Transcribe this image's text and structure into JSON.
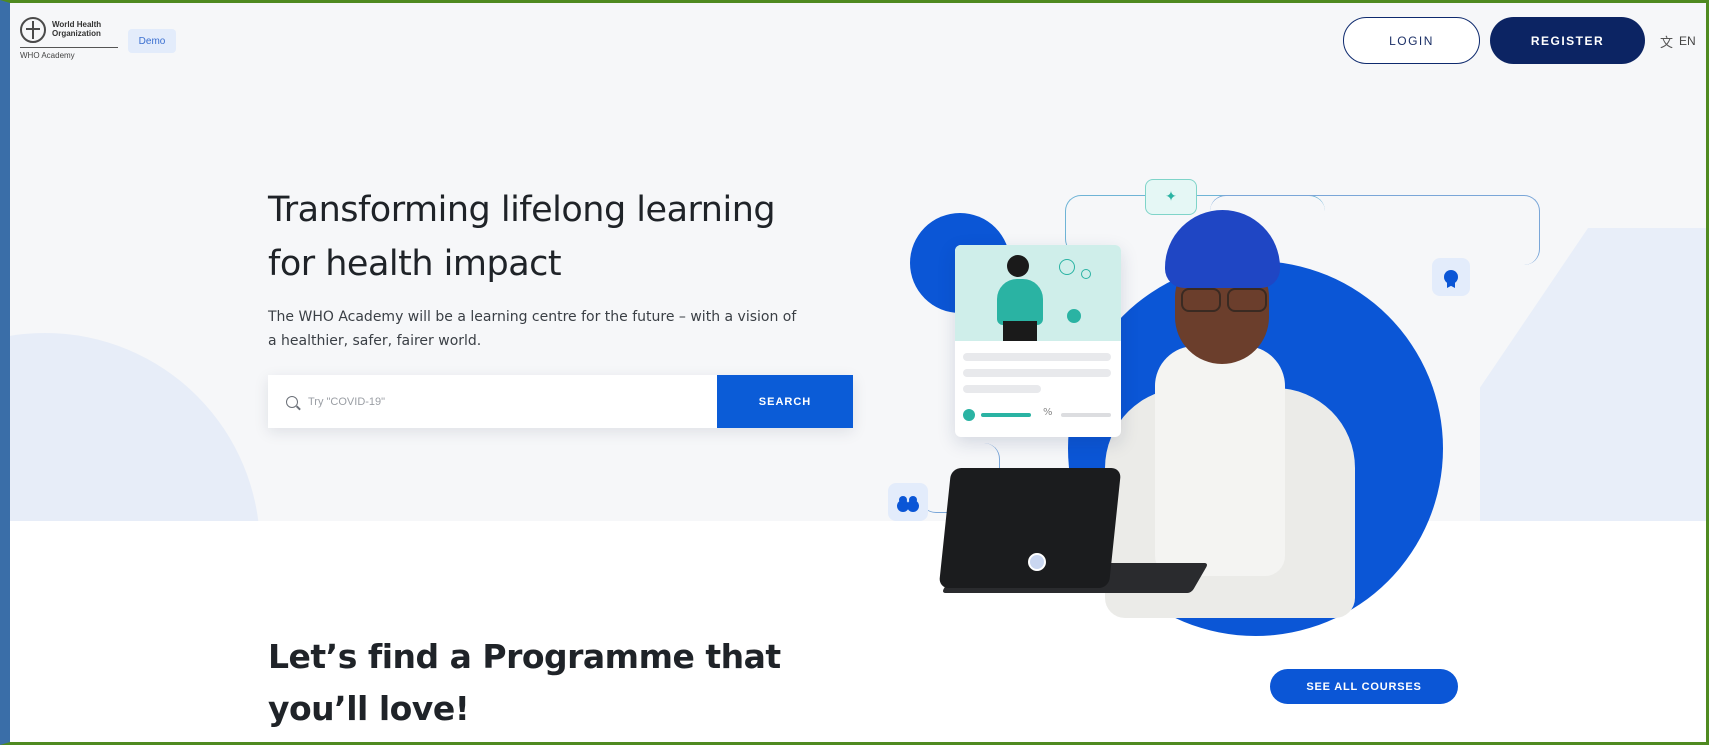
{
  "header": {
    "logo_line1": "World Health",
    "logo_line2": "Organization",
    "logo_sub": "WHO Academy",
    "demo_badge": "Demo",
    "login_label": "LOGIN",
    "register_label": "REGISTER",
    "language": "EN",
    "language_icon": "translate-icon"
  },
  "hero": {
    "title": "Transforming lifelong learning for health impact",
    "subtitle": "The WHO Academy will be a learning centre for the future – with a vision of a healthier, safer, fairer world.",
    "search_placeholder": "Try \"COVID-19\"",
    "search_button": "SEARCH"
  },
  "illustration": {
    "icons": [
      "sparkle-icon",
      "award-icon",
      "users-icon"
    ]
  },
  "programmes": {
    "title": "Let’s find a Programme that you’ll love!",
    "see_all_label": "SEE ALL COURSES"
  },
  "colors": {
    "primary": "#0b56d6",
    "navy": "#0c2463",
    "teal": "#2ab3a3",
    "hero_bg": "#f6f7f9"
  }
}
